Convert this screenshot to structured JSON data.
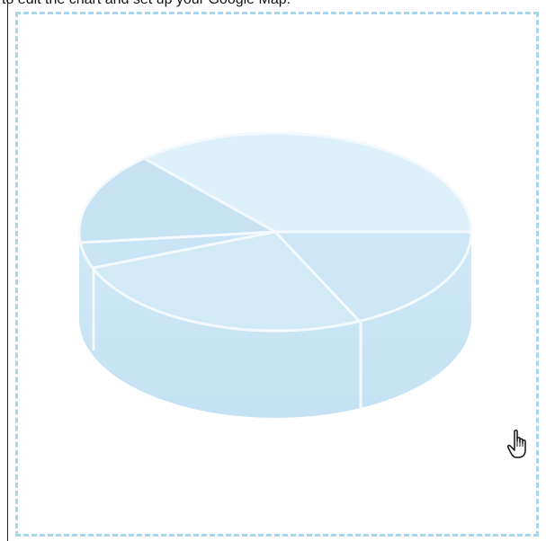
{
  "page": {
    "caption_text": "to edit the chart and set up your Google Map."
  },
  "chart_placeholder": {
    "type": "pie-3d",
    "state": "placeholder",
    "colors": {
      "border": "#a6d6ec",
      "top_face": "#dcedf8",
      "side_face": "#c7e4f4",
      "divider": "#f4f9fd"
    }
  },
  "cursor": {
    "icon": "hand-pointer-icon"
  }
}
